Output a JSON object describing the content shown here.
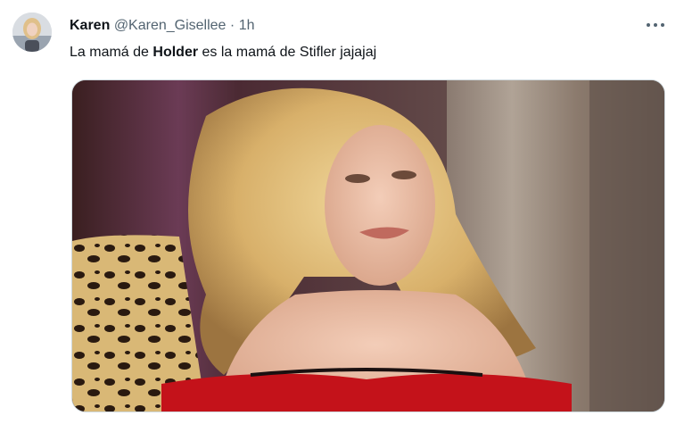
{
  "tweet": {
    "author_name": "Karen",
    "author_handle": "@Karen_Gisellee",
    "separator": "·",
    "time": "1h",
    "text_before": "La mamá de ",
    "text_bold": "Holder",
    "text_after": " es la mamá de Stifler jajajaj"
  },
  "icons": {
    "more": "more-horizontal-icon"
  },
  "colors": {
    "secondary_text": "#536471",
    "primary_text": "#0f1419"
  }
}
